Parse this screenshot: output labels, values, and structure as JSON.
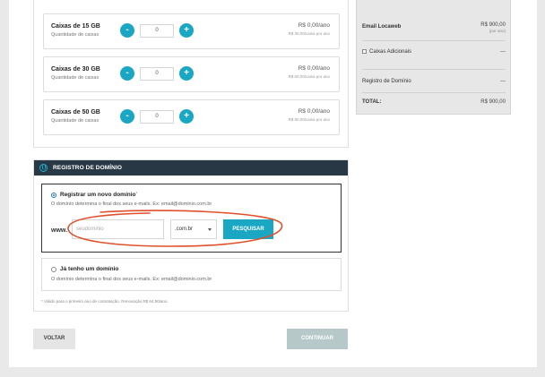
{
  "boxes": [
    {
      "name": "Caixas de 15 GB",
      "sub": "Quantidade de caixas",
      "qty": "0",
      "price": "R$ 0,00/ano",
      "price_sub": "R$ 30,00/caixa por ano"
    },
    {
      "name": "Caixas de 30 GB",
      "sub": "Quantidade de caixas",
      "qty": "0",
      "price": "R$ 0,00/ano",
      "price_sub": "R$ 60,00/caixa por ano"
    },
    {
      "name": "Caixas de 50 GB",
      "sub": "Quantidade de caixas",
      "qty": "0",
      "price": "R$ 0,00/ano",
      "price_sub": "R$ 90,00/caixa por ano"
    }
  ],
  "stepper": {
    "minus": "-",
    "plus": "+"
  },
  "domain": {
    "header": "REGISTRO DE DOMÍNIO",
    "new_option": {
      "label": "Registrar um novo domínio",
      "mark": "*",
      "desc": "O domínio determina o final dos seus e-mails. Ex: email@dominio.com.br"
    },
    "www_label": "www.",
    "input_placeholder": "seudominio",
    "tld_selected": ".com.br",
    "search_button": "PESQUISAR",
    "existing_option": {
      "label": "Já tenho um domínio",
      "desc": "O domínio determina o final dos seus e-mails. Ex: email@dominio.com.br"
    },
    "footnote": "* Válido para o primeiro ano de contratação. Renovação R$ 64,90/ano."
  },
  "actions": {
    "back": "VOLTAR",
    "continue": "CONTINUAR"
  },
  "summary": {
    "product_label": "Email Locaweb",
    "product_value": "R$ 900,00",
    "product_sub": "(por ano)",
    "extra_boxes_label": "Caixas Adicionais",
    "extra_boxes_value": "---",
    "domain_label": "Registro de Domínio",
    "domain_value": "---",
    "total_label": "TOTAL:",
    "total_value": "R$ 900,00"
  },
  "colors": {
    "accent": "#1aa7c4",
    "header": "#283845",
    "annotation": "#e0502a"
  }
}
